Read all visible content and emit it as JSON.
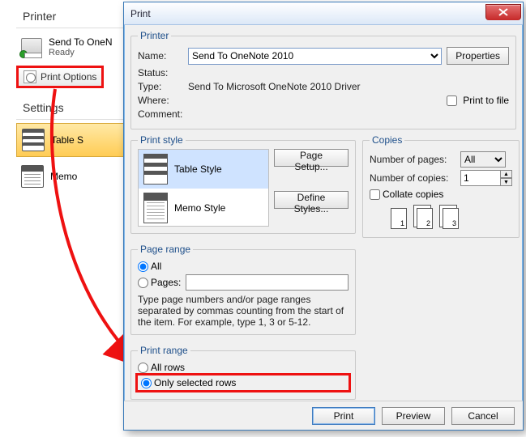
{
  "backstage": {
    "printer_header": "Printer",
    "send_to": "Send To OneN",
    "ready": "Ready",
    "print_options": "Print Options",
    "settings_header": "Settings",
    "styles": [
      {
        "label": "Table S",
        "selected": true
      },
      {
        "label": "Memo",
        "selected": false
      }
    ]
  },
  "dialog": {
    "title": "Print",
    "printer": {
      "legend": "Printer",
      "name_label": "Name:",
      "name_value": "Send To OneNote 2010",
      "properties_btn": "Properties",
      "status_label": "Status:",
      "status_value": "",
      "type_label": "Type:",
      "type_value": "Send To Microsoft OneNote 2010 Driver",
      "where_label": "Where:",
      "where_value": "",
      "comment_label": "Comment:",
      "comment_value": "",
      "print_to_file": "Print to file"
    },
    "print_style": {
      "legend": "Print style",
      "items": [
        {
          "label": "Table Style",
          "selected": true
        },
        {
          "label": "Memo Style",
          "selected": false
        }
      ],
      "page_setup_btn": "Page Setup...",
      "define_styles_btn": "Define Styles..."
    },
    "copies": {
      "legend": "Copies",
      "num_pages_label": "Number of pages:",
      "num_pages_value": "All",
      "num_copies_label": "Number of copies:",
      "num_copies_value": "1",
      "collate_label": "Collate copies"
    },
    "page_range": {
      "legend": "Page range",
      "all_label": "All",
      "pages_label": "Pages:",
      "pages_value": "",
      "hint": "Type page numbers and/or page ranges separated by commas counting from the start of the item.  For example, type 1, 3 or 5-12."
    },
    "print_range": {
      "legend": "Print range",
      "all_rows_label": "All rows",
      "only_selected_label": "Only selected rows"
    },
    "buttons": {
      "print": "Print",
      "preview": "Preview",
      "cancel": "Cancel"
    }
  }
}
